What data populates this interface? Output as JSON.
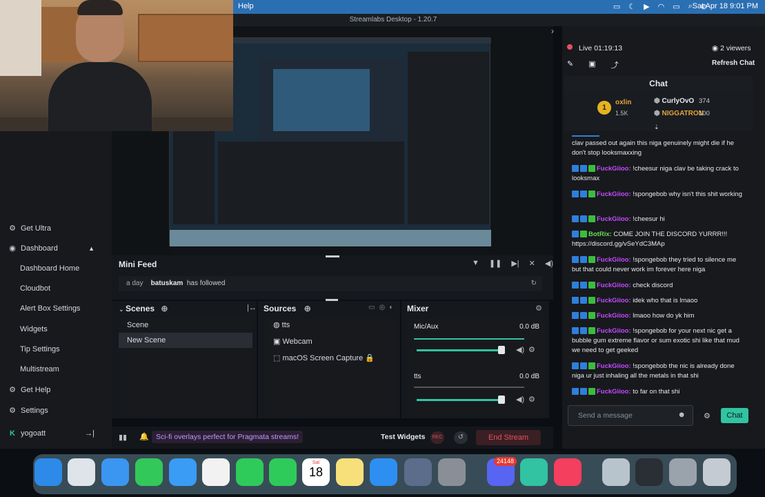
{
  "menubar": {
    "app_menu": "Help",
    "date_time": "Sat Apr 18  9:01 PM"
  },
  "window": {
    "title": "Streamlabs Desktop - 1.20.7"
  },
  "sidebar": {
    "items": [
      {
        "label": "Get Ultra",
        "icon": "ultra-icon"
      },
      {
        "label": "Dashboard",
        "icon": "dashboard-icon"
      },
      {
        "label": "Dashboard Home"
      },
      {
        "label": "Cloudbot"
      },
      {
        "label": "Alert Box Settings"
      },
      {
        "label": "Widgets"
      },
      {
        "label": "Tip Settings"
      },
      {
        "label": "Multistream"
      },
      {
        "label": "Get Help",
        "icon": "help-icon"
      },
      {
        "label": "Settings",
        "icon": "gear-icon"
      }
    ],
    "user": "yogoatt"
  },
  "minifeed": {
    "title": "Mini Feed",
    "event_time": "a day",
    "event_user": "batuskam",
    "event_text": "has followed"
  },
  "scenes": {
    "title": "Scenes",
    "items": [
      "Scene",
      "New Scene"
    ]
  },
  "sources": {
    "title": "Sources",
    "items": [
      "tts",
      "Webcam",
      "macOS Screen Capture"
    ]
  },
  "mixer": {
    "title": "Mixer",
    "channels": [
      {
        "name": "Mic/Aux",
        "db": "0.0 dB"
      },
      {
        "name": "tts",
        "db": "0.0 dB"
      }
    ]
  },
  "bottom": {
    "promo": "Sci-fi overlays perfect for Pragmata streams!",
    "test_widgets": "Test Widgets",
    "rec": "REC",
    "end_stream": "End Stream"
  },
  "stream": {
    "status": "Live",
    "elapsed": "01:19:13",
    "viewers": "2 viewers",
    "refresh": "Refresh Chat"
  },
  "chat": {
    "title": "Chat",
    "top": {
      "rank1_user": "oxlin",
      "rank1_amount": "1.5K",
      "u2": "CurlyOvO",
      "u2_amount": "374",
      "u3": "NIGGATRON",
      "u3_amount": "100"
    },
    "messages": [
      {
        "user": "",
        "text": "clav passed out again this niga genuinely might die if he don't stop looksmaxxing"
      },
      {
        "user": "FuckGiioo:",
        "text": "!cheesur niga clav be taking crack to looksmax"
      },
      {
        "user": "FuckGiioo:",
        "text": "!spongebob why isn't this shit working"
      },
      {
        "user": "FuckGiioo:",
        "text": "!cheesur hi"
      },
      {
        "user": "BotRix:",
        "text": "COME JOIN THE DISCORD YURRR!!! https://discord.gg/vSeYdC3MAp",
        "bot": true
      },
      {
        "user": "FuckGiioo:",
        "text": "!spongebob they tried to silence me but that could never work im forever here niga"
      },
      {
        "user": "FuckGiioo:",
        "text": "check discord"
      },
      {
        "user": "FuckGiioo:",
        "text": "idek who that is lmaoo"
      },
      {
        "user": "FuckGiioo:",
        "text": "lmaoo how do yk him"
      },
      {
        "user": "FuckGiioo:",
        "text": "!spongebob for your next nic get a bubble gum extreme flavor or sum exotic shi like that mud we need to get geeked"
      },
      {
        "user": "FuckGiioo:",
        "text": "!spongebob the nic is already done niga ur just inhaling all the metals in that shi"
      },
      {
        "user": "FuckGiioo:",
        "text": "to far on that shi"
      }
    ],
    "input_placeholder": "Send a message",
    "send": "Chat"
  },
  "dock": {
    "calendar_day": "Sat",
    "calendar_date": "18",
    "discord_badge": "24148"
  }
}
